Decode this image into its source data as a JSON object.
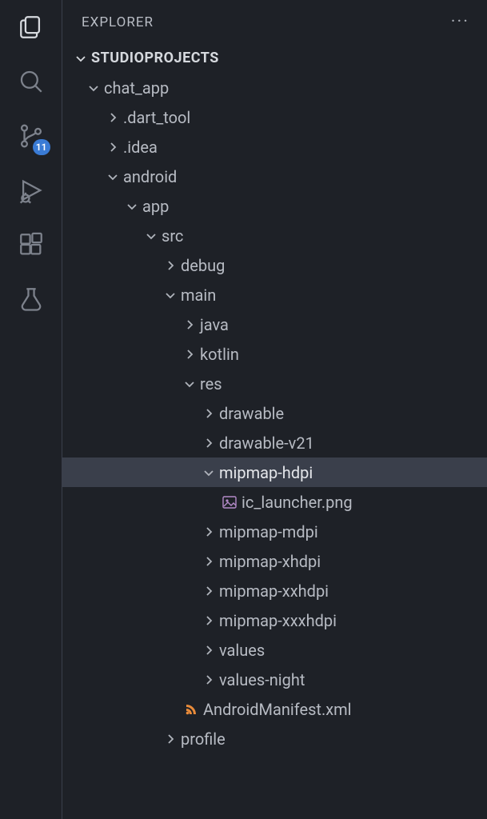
{
  "sidebar_title": "EXPLORER",
  "project_name": "STUDIOPROJECTS",
  "scm_badge": "11",
  "tree": [
    {
      "depth": 0,
      "kind": "folder",
      "expanded": true,
      "label": "chat_app"
    },
    {
      "depth": 1,
      "kind": "folder",
      "expanded": false,
      "label": ".dart_tool"
    },
    {
      "depth": 1,
      "kind": "folder",
      "expanded": false,
      "label": ".idea"
    },
    {
      "depth": 1,
      "kind": "folder",
      "expanded": true,
      "label": "android"
    },
    {
      "depth": 2,
      "kind": "folder",
      "expanded": true,
      "label": "app"
    },
    {
      "depth": 3,
      "kind": "folder",
      "expanded": true,
      "label": "src"
    },
    {
      "depth": 4,
      "kind": "folder",
      "expanded": false,
      "label": "debug"
    },
    {
      "depth": 4,
      "kind": "folder",
      "expanded": true,
      "label": "main"
    },
    {
      "depth": 5,
      "kind": "folder",
      "expanded": false,
      "label": "java"
    },
    {
      "depth": 5,
      "kind": "folder",
      "expanded": false,
      "label": "kotlin"
    },
    {
      "depth": 5,
      "kind": "folder",
      "expanded": true,
      "label": "res"
    },
    {
      "depth": 6,
      "kind": "folder",
      "expanded": false,
      "label": "drawable"
    },
    {
      "depth": 6,
      "kind": "folder",
      "expanded": false,
      "label": "drawable-v21"
    },
    {
      "depth": 6,
      "kind": "folder",
      "expanded": true,
      "label": "mipmap-hdpi",
      "selected": true
    },
    {
      "depth": 7,
      "kind": "file",
      "icon": "image",
      "label": "ic_launcher.png"
    },
    {
      "depth": 6,
      "kind": "folder",
      "expanded": false,
      "label": "mipmap-mdpi"
    },
    {
      "depth": 6,
      "kind": "folder",
      "expanded": false,
      "label": "mipmap-xhdpi"
    },
    {
      "depth": 6,
      "kind": "folder",
      "expanded": false,
      "label": "mipmap-xxhdpi"
    },
    {
      "depth": 6,
      "kind": "folder",
      "expanded": false,
      "label": "mipmap-xxxhdpi"
    },
    {
      "depth": 6,
      "kind": "folder",
      "expanded": false,
      "label": "values"
    },
    {
      "depth": 6,
      "kind": "folder",
      "expanded": false,
      "label": "values-night"
    },
    {
      "depth": 5,
      "kind": "file",
      "icon": "xml",
      "label": "AndroidManifest.xml"
    },
    {
      "depth": 4,
      "kind": "folder",
      "expanded": false,
      "label": "profile"
    }
  ]
}
